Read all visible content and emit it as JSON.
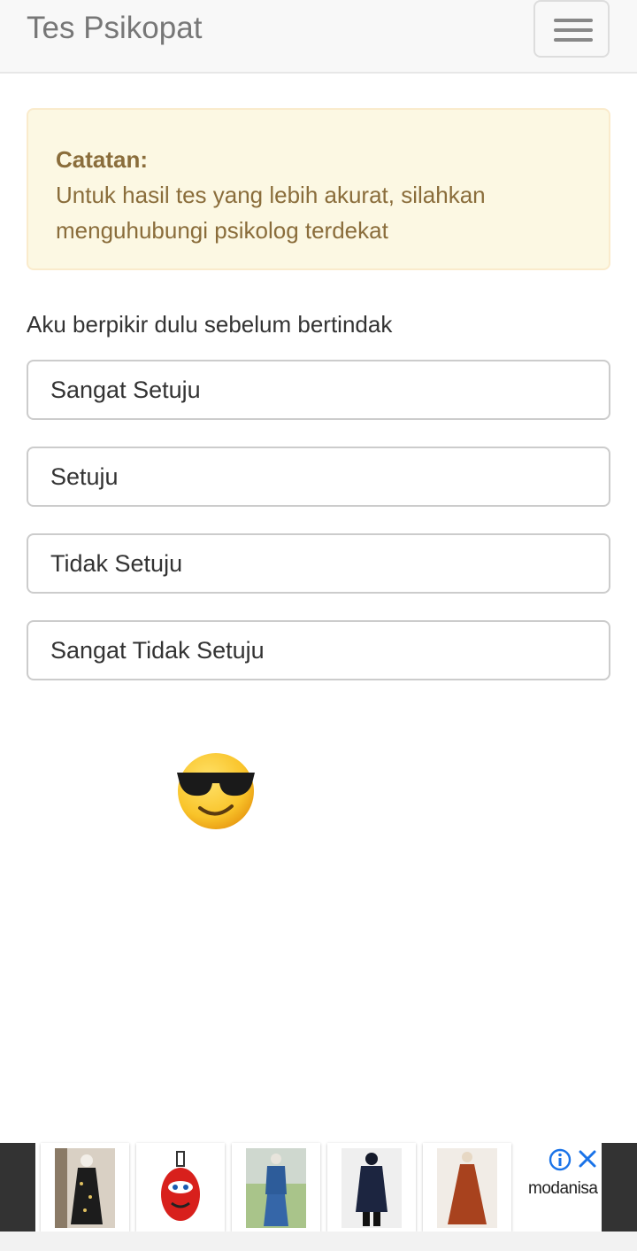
{
  "navbar": {
    "brand": "Tes Psikopat",
    "toggle_icon": "hamburger-menu-icon"
  },
  "alert": {
    "label": "Catatan:",
    "line1": "Untuk hasil tes yang lebih akurat, silahkan",
    "line2": "menguhubungi psikolog terdekat"
  },
  "question": "Aku berpikir dulu sebelum bertindak",
  "options": [
    "Sangat Setuju",
    "Setuju",
    "Tidak Setuju",
    "Sangat Tidak Setuju"
  ],
  "emoji": "smiling-face-with-sunglasses",
  "ad": {
    "brand": "modanisa",
    "products": [
      "floral-dress",
      "kids-trolley-bag",
      "denim-suit",
      "navy-tunic",
      "rust-maxi-dress"
    ],
    "colors": {
      "accent": "#1a73e8"
    }
  },
  "colors": {
    "alert_bg": "#fcf8e3",
    "alert_text": "#8a6d3b",
    "navbar_bg": "#f8f8f8"
  }
}
